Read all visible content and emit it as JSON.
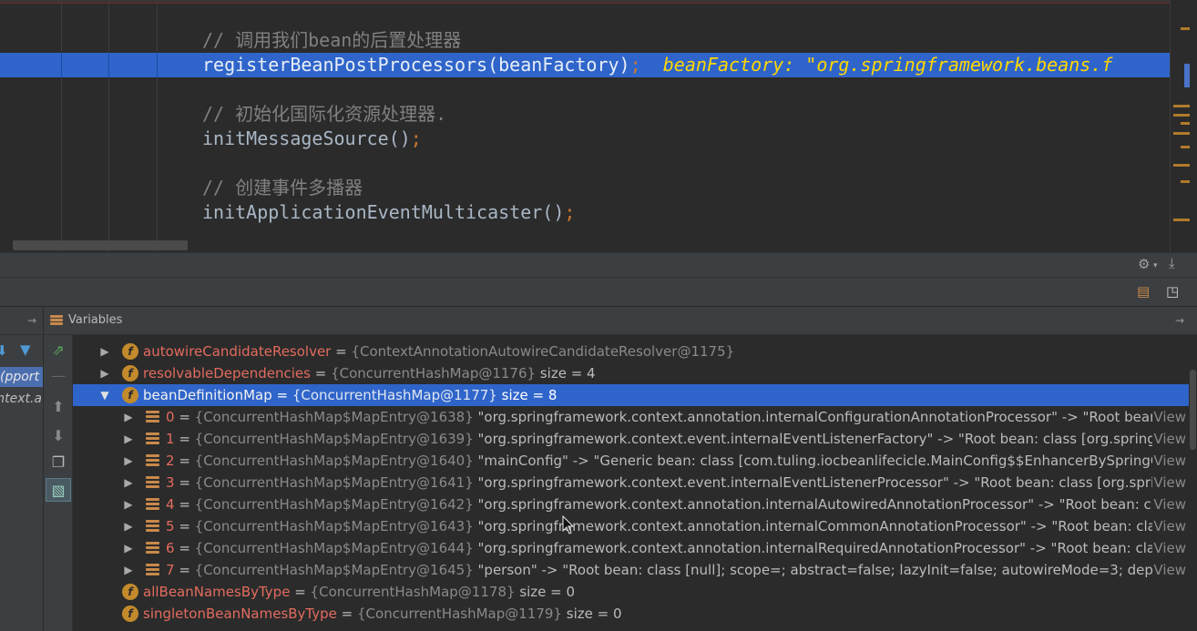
{
  "editor": {
    "lines": [
      {
        "id": "comment1",
        "text": "// 调用我们bean的后置处理器",
        "kind": "comment"
      },
      {
        "id": "exec",
        "code": "registerBeanPostProcessors(beanFactory)",
        "semi": ";",
        "inline_value": "beanFactory: \"org.springframework.beans.f"
      },
      {
        "id": "comment2",
        "text": "// 初始化国际化资源处理器.",
        "kind": "comment"
      },
      {
        "id": "code2",
        "code": "initMessageSource()",
        "semi": ";"
      },
      {
        "id": "comment3",
        "text": "// 创建事件多播器",
        "kind": "comment"
      },
      {
        "id": "code3",
        "code": "initApplicationEventMulticaster()",
        "semi": ";"
      }
    ]
  },
  "toolbars": {
    "settings_icon": "gear-icon",
    "download_icon": "download-icon"
  },
  "panel": {
    "title": "Variables",
    "pin_glyph": "→"
  },
  "frames": [
    {
      "label": "pport)",
      "selected": true
    },
    {
      "label": "ntext.a",
      "selected": false
    }
  ],
  "variables": [
    {
      "id": "autowireCandidateResolver",
      "kind": "field",
      "name": "autowireCandidateResolver",
      "type": "{ContextAnnotationAutowireCandidateResolver@1175}",
      "extra": "",
      "expanded": false
    },
    {
      "id": "resolvableDependencies",
      "kind": "field",
      "name": "resolvableDependencies",
      "type": "{ConcurrentHashMap@1176}",
      "extra": "size = 4",
      "expanded": false
    },
    {
      "id": "beanDefinitionMap",
      "kind": "field",
      "name": "beanDefinitionMap",
      "type": "{ConcurrentHashMap@1177}",
      "extra": "size = 8",
      "expanded": true,
      "selected": true
    },
    {
      "id": "e0",
      "kind": "entry",
      "name": "0",
      "type": "{ConcurrentHashMap$MapEntry@1638}",
      "extra": "\"org.springframework.context.annotation.internalConfigurationAnnotationProcessor\" -> \"Root bean: c",
      "view": "View"
    },
    {
      "id": "e1",
      "kind": "entry",
      "name": "1",
      "type": "{ConcurrentHashMap$MapEntry@1639}",
      "extra": "\"org.springframework.context.event.internalEventListenerFactory\" -> \"Root bean: class [org.springfram",
      "view": "View"
    },
    {
      "id": "e2",
      "kind": "entry",
      "name": "2",
      "type": "{ConcurrentHashMap$MapEntry@1640}",
      "extra": "\"mainConfig\" -> \"Generic bean: class [com.tuling.iocbeanlifecicle.MainConfig$$EnhancerBySpringCGLII...",
      "view": "View"
    },
    {
      "id": "e3",
      "kind": "entry",
      "name": "3",
      "type": "{ConcurrentHashMap$MapEntry@1641}",
      "extra": "\"org.springframework.context.event.internalEventListenerProcessor\" -> \"Root bean: class [org.springfi...",
      "view": "View"
    },
    {
      "id": "e4",
      "kind": "entry",
      "name": "4",
      "type": "{ConcurrentHashMap$MapEntry@1642}",
      "extra": "\"org.springframework.context.annotation.internalAutowiredAnnotationProcessor\" -> \"Root bean: clas...",
      "view": "View"
    },
    {
      "id": "e5",
      "kind": "entry",
      "name": "5",
      "type": "{ConcurrentHashMap$MapEntry@1643}",
      "extra": "\"org.springframework.context.annotation.internalCommonAnnotationProcessor\" -> \"Root bean: class ...",
      "view": "View"
    },
    {
      "id": "e6",
      "kind": "entry",
      "name": "6",
      "type": "{ConcurrentHashMap$MapEntry@1644}",
      "extra": "\"org.springframework.context.annotation.internalRequiredAnnotationProcessor\" -> \"Root bean: class ...",
      "view": "View"
    },
    {
      "id": "e7",
      "kind": "entry",
      "name": "7",
      "type": "{ConcurrentHashMap$MapEntry@1645}",
      "extra": "\"person\" -> \"Root bean: class [null]; scope=; abstract=false; lazyInit=false; autowireMode=3; dependen...",
      "view": "View"
    },
    {
      "id": "allBeanNamesByType",
      "kind": "field-leaf",
      "name": "allBeanNamesByType",
      "type": "{ConcurrentHashMap@1178}",
      "extra": "size = 0"
    },
    {
      "id": "singletonBeanNamesByType",
      "kind": "field-leaf",
      "name": "singletonBeanNamesByType",
      "type": "{ConcurrentHashMap@1179}",
      "extra": "size = 0"
    }
  ],
  "colors": {
    "accent_selection": "#2f65ca",
    "field_name": "#e36b5e",
    "field_icon": "#c38a2c",
    "inline_value": "#ffd700"
  }
}
